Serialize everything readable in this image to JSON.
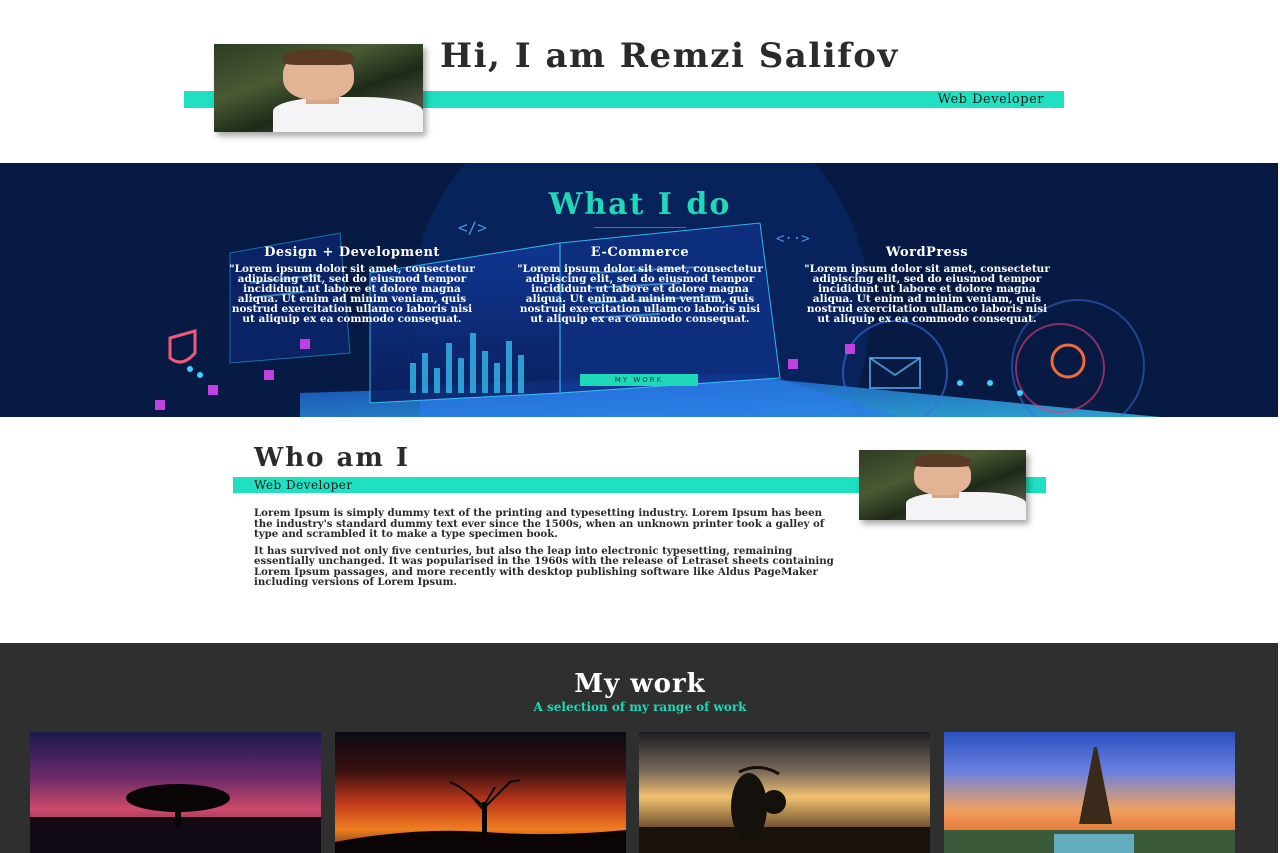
{
  "nav": {
    "menu_icon": "hamburger-icon"
  },
  "hero": {
    "title": "Hi, I am Remzi Salifov",
    "subtitle": "Web Developer"
  },
  "what_i_do": {
    "title": "What I do",
    "services": [
      {
        "title": "Design + Development",
        "text": "\"Lorem ipsum dolor sit amet, consectetur adipiscing elit, sed do eiusmod tempor incididunt ut labore et dolore magna aliqua. Ut enim ad minim veniam, quis nostrud exercitation ullamco laboris nisi ut aliquip ex ea commodo consequat."
      },
      {
        "title": "E-Commerce",
        "text": "\"Lorem ipsum dolor sit amet, consectetur adipiscing elit, sed do eiusmod tempor incididunt ut labore et dolore magna aliqua. Ut enim ad minim veniam, quis nostrud exercitation ullamco laboris nisi ut aliquip ex ea commodo consequat."
      },
      {
        "title": "WordPress",
        "text": "\"Lorem ipsum dolor sit amet, consectetur adipiscing elit, sed do eiusmod tempor incididunt ut labore et dolore magna aliqua. Ut enim ad minim veniam, quis nostrud exercitation ullamco laboris nisi ut aliquip ex ea commodo consequat."
      }
    ],
    "button_label": "MY WORK"
  },
  "who": {
    "title": "Who am I",
    "subtitle": "Web Developer",
    "paragraphs": [
      "Lorem Ipsum is simply dummy text of the printing and typesetting industry. Lorem Ipsum has been the industry's standard dummy text ever since the 1500s, when an unknown printer took a galley of type and scrambled it to make a type specimen book.",
      "It has survived not only five centuries, but also the leap into electronic typesetting, remaining essentially unchanged. It was popularised in the 1960s with the release of Letraset sheets containing Lorem Ipsum passages, and more recently with desktop publishing software like Aldus PageMaker including versions of Lorem Ipsum."
    ]
  },
  "my_work": {
    "title": "My work",
    "subtitle": "A selection of my range of work"
  },
  "colors": {
    "accent": "#1fd8b8",
    "dark_navy": "#061a44",
    "dark_gray": "#2f2f2f"
  }
}
